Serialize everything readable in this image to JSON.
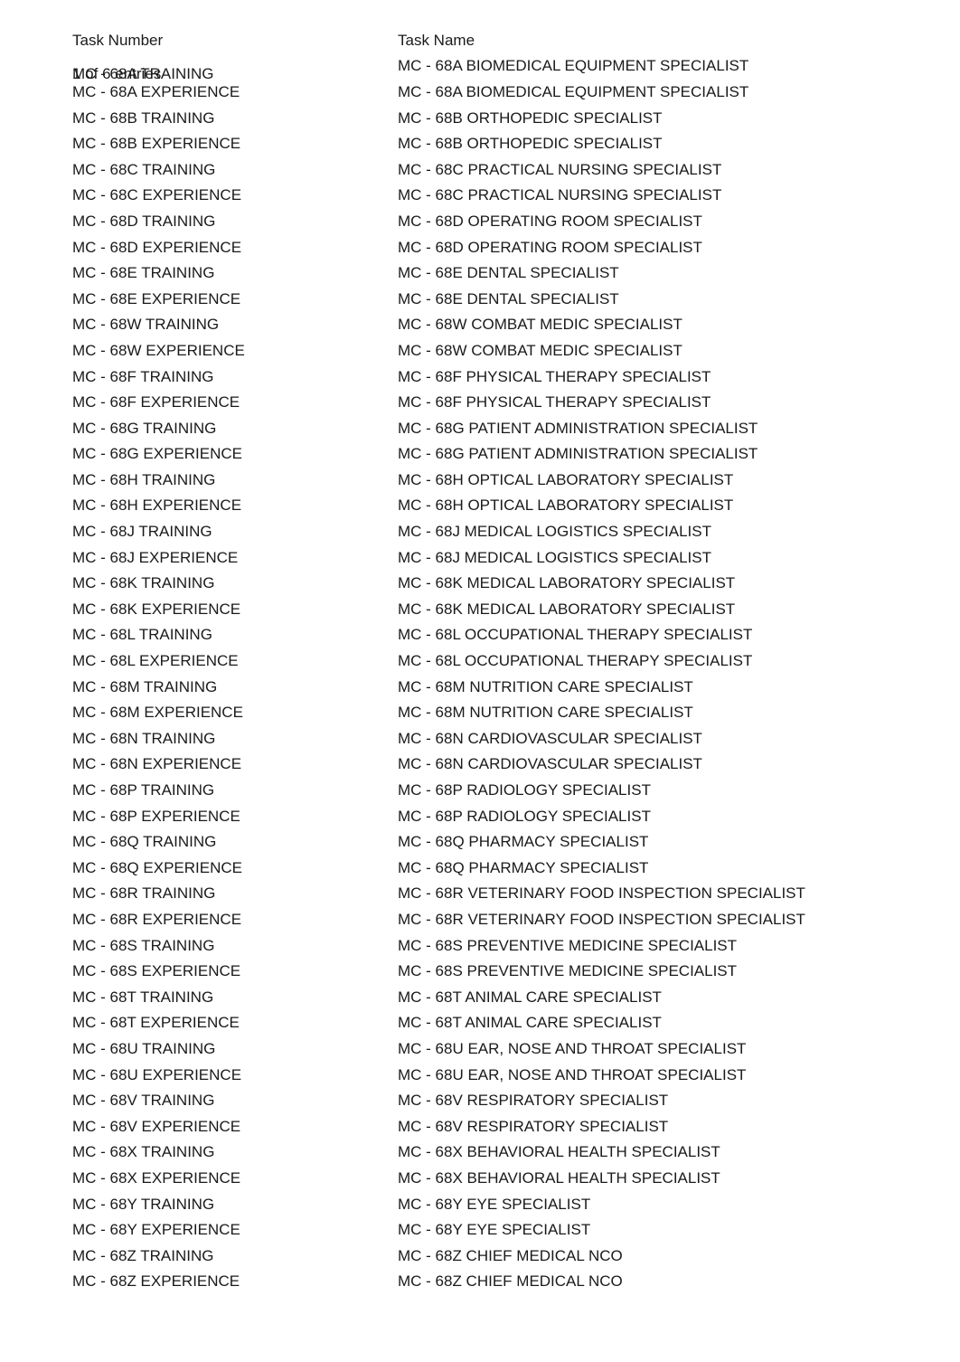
{
  "header": {
    "col1": "Task Number",
    "col2": "Task Name"
  },
  "overlap": {
    "text1": "MC - 68A TRAINING",
    "text2": "1 of 6 entries"
  },
  "rows": [
    {
      "num": "",
      "name": "MC - 68A BIOMEDICAL EQUIPMENT SPECIALIST"
    },
    {
      "num": "MC - 68A EXPERIENCE",
      "name": "MC - 68A BIOMEDICAL EQUIPMENT SPECIALIST"
    },
    {
      "num": "MC - 68B TRAINING",
      "name": "MC - 68B ORTHOPEDIC SPECIALIST"
    },
    {
      "num": "MC - 68B EXPERIENCE",
      "name": "MC - 68B ORTHOPEDIC SPECIALIST"
    },
    {
      "num": "MC - 68C TRAINING",
      "name": "MC - 68C PRACTICAL NURSING SPECIALIST"
    },
    {
      "num": "MC - 68C EXPERIENCE",
      "name": "MC - 68C PRACTICAL NURSING SPECIALIST"
    },
    {
      "num": "MC - 68D TRAINING",
      "name": "MC - 68D OPERATING ROOM SPECIALIST"
    },
    {
      "num": "MC - 68D EXPERIENCE",
      "name": "MC - 68D OPERATING ROOM SPECIALIST"
    },
    {
      "num": "MC - 68E TRAINING",
      "name": "MC - 68E DENTAL SPECIALIST"
    },
    {
      "num": "MC - 68E EXPERIENCE",
      "name": "MC - 68E DENTAL SPECIALIST"
    },
    {
      "num": "MC - 68W TRAINING",
      "name": "MC - 68W COMBAT MEDIC SPECIALIST"
    },
    {
      "num": "MC - 68W EXPERIENCE",
      "name": "MC - 68W COMBAT MEDIC SPECIALIST"
    },
    {
      "num": "MC - 68F TRAINING",
      "name": "MC - 68F PHYSICAL THERAPY SPECIALIST"
    },
    {
      "num": "MC - 68F EXPERIENCE",
      "name": "MC - 68F PHYSICAL THERAPY SPECIALIST"
    },
    {
      "num": "MC - 68G TRAINING",
      "name": "MC - 68G PATIENT ADMINISTRATION SPECIALIST"
    },
    {
      "num": "MC - 68G EXPERIENCE",
      "name": "MC - 68G PATIENT ADMINISTRATION SPECIALIST"
    },
    {
      "num": "MC - 68H TRAINING",
      "name": "MC - 68H OPTICAL LABORATORY SPECIALIST"
    },
    {
      "num": "MC - 68H EXPERIENCE",
      "name": "MC - 68H OPTICAL LABORATORY SPECIALIST"
    },
    {
      "num": "MC - 68J TRAINING",
      "name": "MC - 68J MEDICAL LOGISTICS SPECIALIST"
    },
    {
      "num": "MC - 68J EXPERIENCE",
      "name": "MC - 68J MEDICAL LOGISTICS SPECIALIST"
    },
    {
      "num": "MC - 68K TRAINING",
      "name": "MC - 68K MEDICAL LABORATORY SPECIALIST"
    },
    {
      "num": "MC - 68K EXPERIENCE",
      "name": "MC - 68K MEDICAL LABORATORY SPECIALIST"
    },
    {
      "num": "MC - 68L TRAINING",
      "name": "MC - 68L OCCUPATIONAL THERAPY SPECIALIST"
    },
    {
      "num": "MC - 68L EXPERIENCE",
      "name": "MC - 68L OCCUPATIONAL THERAPY SPECIALIST"
    },
    {
      "num": "MC - 68M TRAINING",
      "name": "MC - 68M NUTRITION CARE SPECIALIST"
    },
    {
      "num": "MC - 68M EXPERIENCE",
      "name": "MC - 68M NUTRITION CARE SPECIALIST"
    },
    {
      "num": "MC - 68N TRAINING",
      "name": "MC - 68N CARDIOVASCULAR SPECIALIST"
    },
    {
      "num": "MC - 68N EXPERIENCE",
      "name": "MC - 68N CARDIOVASCULAR SPECIALIST"
    },
    {
      "num": "MC - 68P TRAINING",
      "name": "MC - 68P RADIOLOGY SPECIALIST"
    },
    {
      "num": "MC - 68P EXPERIENCE",
      "name": "MC - 68P RADIOLOGY SPECIALIST"
    },
    {
      "num": "MC - 68Q TRAINING",
      "name": "MC - 68Q PHARMACY SPECIALIST"
    },
    {
      "num": "MC - 68Q EXPERIENCE",
      "name": "MC - 68Q PHARMACY SPECIALIST"
    },
    {
      "num": "MC - 68R TRAINING",
      "name": "MC - 68R VETERINARY FOOD INSPECTION SPECIALIST"
    },
    {
      "num": "MC - 68R EXPERIENCE",
      "name": "MC - 68R VETERINARY FOOD INSPECTION SPECIALIST"
    },
    {
      "num": "MC - 68S TRAINING",
      "name": "MC - 68S PREVENTIVE MEDICINE SPECIALIST"
    },
    {
      "num": "MC - 68S EXPERIENCE",
      "name": "MC - 68S PREVENTIVE MEDICINE SPECIALIST"
    },
    {
      "num": "MC - 68T TRAINING",
      "name": "MC - 68T ANIMAL CARE SPECIALIST"
    },
    {
      "num": "MC - 68T EXPERIENCE",
      "name": "MC - 68T ANIMAL CARE SPECIALIST"
    },
    {
      "num": "MC - 68U TRAINING",
      "name": "MC - 68U EAR, NOSE AND THROAT SPECIALIST"
    },
    {
      "num": "MC - 68U EXPERIENCE",
      "name": "MC - 68U EAR, NOSE AND THROAT SPECIALIST"
    },
    {
      "num": "MC - 68V TRAINING",
      "name": "MC - 68V RESPIRATORY SPECIALIST"
    },
    {
      "num": "MC - 68V EXPERIENCE",
      "name": "MC - 68V RESPIRATORY SPECIALIST"
    },
    {
      "num": "MC - 68X TRAINING",
      "name": "MC - 68X BEHAVIORAL HEALTH SPECIALIST"
    },
    {
      "num": "MC - 68X EXPERIENCE",
      "name": "MC - 68X BEHAVIORAL HEALTH SPECIALIST"
    },
    {
      "num": "MC - 68Y TRAINING",
      "name": "MC - 68Y EYE SPECIALIST"
    },
    {
      "num": "MC - 68Y EXPERIENCE",
      "name": "MC - 68Y EYE SPECIALIST"
    },
    {
      "num": "MC - 68Z TRAINING",
      "name": "MC - 68Z CHIEF MEDICAL NCO"
    },
    {
      "num": "MC - 68Z EXPERIENCE",
      "name": "MC - 68Z CHIEF MEDICAL NCO"
    }
  ]
}
